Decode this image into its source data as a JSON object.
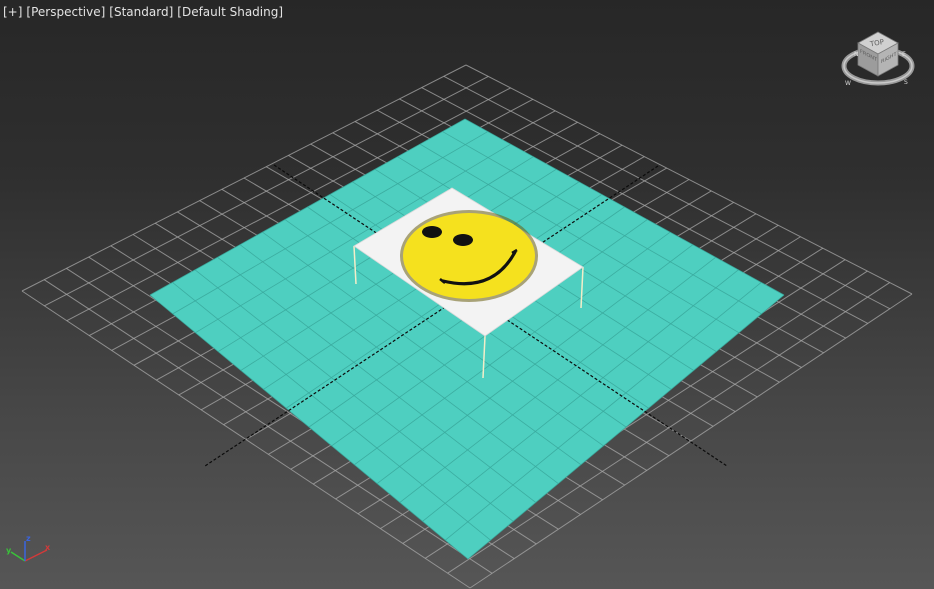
{
  "viewport": {
    "labels": [
      "[+]",
      "[Perspective]",
      "[Standard]",
      "[Default Shading]"
    ]
  },
  "viewcube": {
    "top_face": "TOP",
    "front_face": "FRONT",
    "right_face": "RIGHT",
    "compass": [
      "N",
      "W",
      "S",
      "E"
    ]
  },
  "axis_tripod": {
    "x": "x",
    "y": "y",
    "z": "z"
  },
  "colors": {
    "plane": "#4ecfc0",
    "grid": "#a8a8a8",
    "axis_line": "#0b0b0b",
    "table_top": "#f3f3f3",
    "smiley": "#f5e11e",
    "table_leg": "#f2edc8"
  }
}
